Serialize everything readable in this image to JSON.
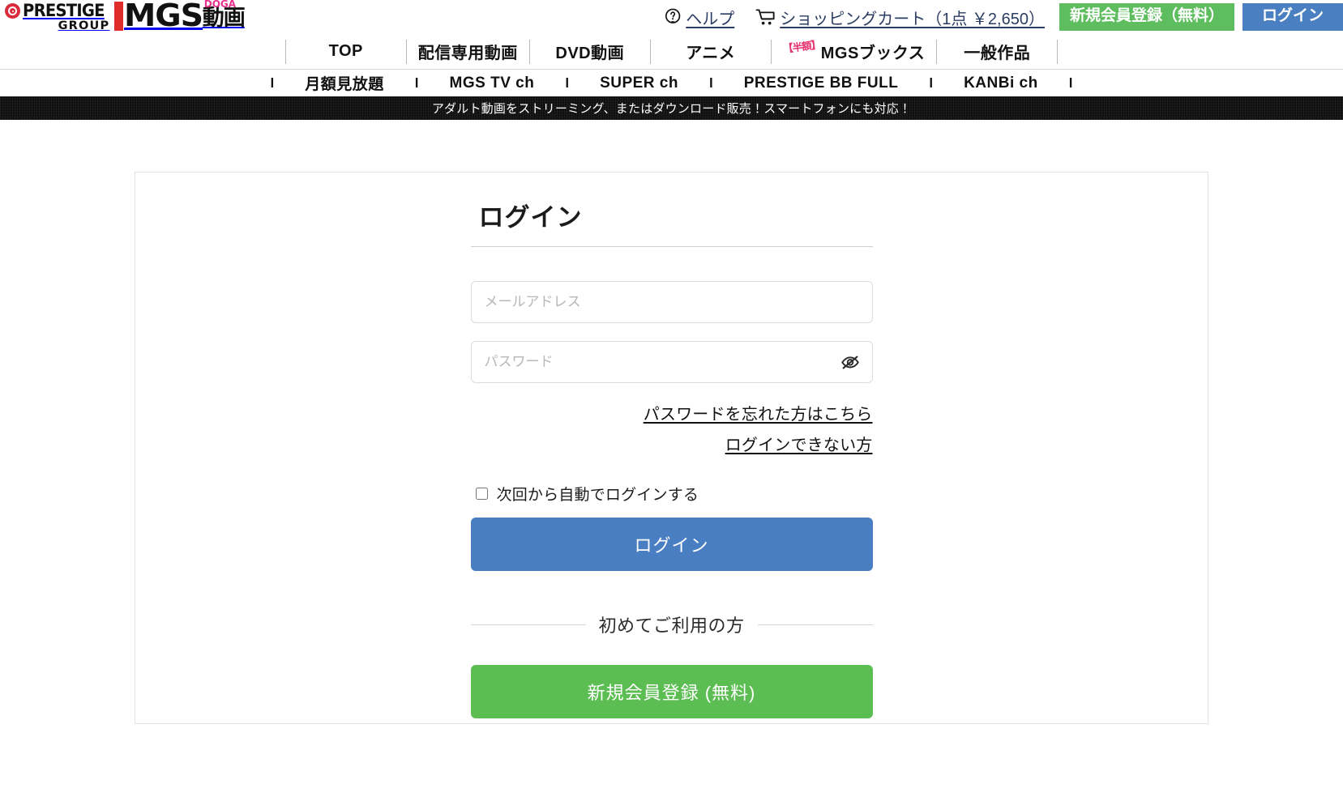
{
  "header": {
    "logo": {
      "prestige_word": "PRESTIGE",
      "prestige_group": "GROUP",
      "mgs_text": "MGS",
      "doga_small": "DOGA",
      "doga_jp": "動画"
    },
    "help_link": "ヘルプ",
    "help_icon": "question-mark-circle-icon",
    "cart_link": "ショッピングカート（1点 ￥2,650）",
    "cart_icon": "shopping-cart-icon",
    "register_button": "新規会員登録（無料）",
    "login_button": "ログイン",
    "register_color": "#5ebd5e",
    "login_color": "#4a7fc1"
  },
  "nav_main": [
    {
      "label": "TOP",
      "badge": ""
    },
    {
      "label": "配信専用動画",
      "badge": ""
    },
    {
      "label": "DVD動画",
      "badge": ""
    },
    {
      "label": "アニメ",
      "badge": ""
    },
    {
      "label": "MGSブックス",
      "badge": "【半額】"
    },
    {
      "label": "一般作品",
      "badge": ""
    }
  ],
  "nav_sub": {
    "pipe": "l",
    "items": [
      {
        "label": "月額見放題"
      },
      {
        "label": "MGS TV ch"
      },
      {
        "label": "SUPER ch"
      },
      {
        "label": "PRESTIGE BB FULL"
      },
      {
        "label": "KANBi ch"
      }
    ]
  },
  "banner": {
    "text": "アダルト動画をストリーミング、またはダウンロード販売！スマートフォンにも対応！"
  },
  "login_form": {
    "title": "ログイン",
    "email_placeholder": "メールアドレス",
    "email_value": "",
    "password_placeholder": "パスワード",
    "password_value": "",
    "toggle_password_icon": "eye-slash-icon",
    "forgot_password_link": "パスワードを忘れた方はこちら",
    "cannot_login_link": "ログインできない方",
    "remember_label": "次回から自動でログインする",
    "remember_checked": false,
    "submit_label": "ログイン",
    "submit_color": "#4a7ec2",
    "divider_text": "初めてご利用の方",
    "register_label": "新規会員登録 (無料)",
    "register_color": "#5cbd53"
  }
}
